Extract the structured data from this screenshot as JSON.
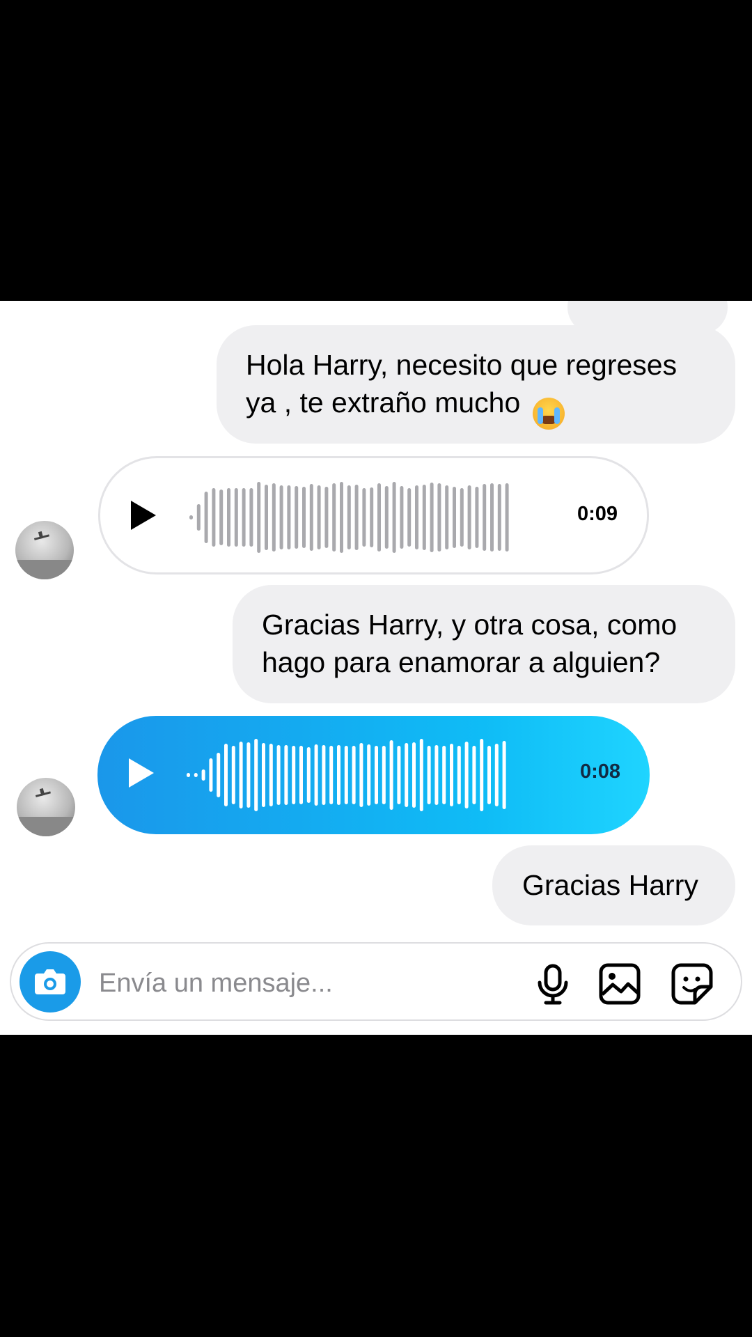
{
  "chat": {
    "messages": [
      {
        "type": "text",
        "sender": "me",
        "text": "Hola Harry, necesito que regreses ya , te extraño mucho",
        "emoji": "crying-face-emoji"
      },
      {
        "type": "voice",
        "sender": "them",
        "duration": "0:09",
        "style": "outline"
      },
      {
        "type": "text",
        "sender": "me",
        "text": "Gracias Harry, y otra cosa, como hago para enamorar a alguien?"
      },
      {
        "type": "voice",
        "sender": "them",
        "duration": "0:08",
        "style": "filled"
      },
      {
        "type": "text",
        "sender": "me",
        "text": "Gracias Harry"
      }
    ]
  },
  "composer": {
    "placeholder": "Envía un mensaje...",
    "icons": [
      "camera-icon",
      "microphone-icon",
      "gallery-icon",
      "sticker-icon"
    ]
  },
  "colors": {
    "bubble_out": "#efeff1",
    "voice_gradient_start": "#1a97ea",
    "voice_gradient_end": "#1fd4ff",
    "camera_button": "#1a9be8"
  }
}
